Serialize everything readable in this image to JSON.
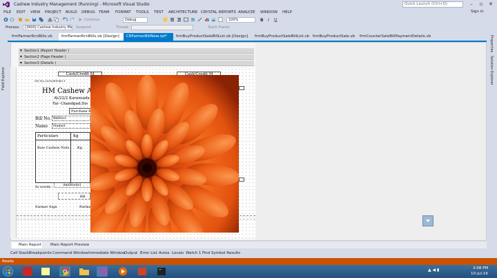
{
  "window": {
    "title": "Cashew Industry Management (Running) - Microsoft Visual Studio",
    "quick_launch_placeholder": "Quick Launch (Ctrl+Q)",
    "sign_in": "Sign in"
  },
  "menu": [
    "FILE",
    "EDIT",
    "VIEW",
    "PROJECT",
    "BUILD",
    "DEBUG",
    "TEAM",
    "FORMAT",
    "TOOLS",
    "TEST",
    "ARCHITECTURE",
    "CRYSTAL REPORTS",
    "ANALYZE",
    "WINDOW",
    "HELP"
  ],
  "toolbar": {
    "continue_label": "Continue",
    "debug_config": "Debug",
    "zoom": "100%"
  },
  "processbar": {
    "process_label": "Process:",
    "process_value": "[3900] Cashew Industry Managem",
    "suspend": "Suspend",
    "thread": "Thread:",
    "stack_frame": "Stack Frame:"
  },
  "left_tabs": [
    "Field Explorer"
  ],
  "right_tabs": [
    "Properties",
    "Solution Explorer"
  ],
  "doc_tabs": [
    {
      "label": "frmFarmerRcnBills.vb",
      "state": "normal"
    },
    {
      "label": "frmFarmerRcnBills.vb [Design]",
      "state": "hot"
    },
    {
      "label": "CRFarmerBillNew.rpt*",
      "state": "selected"
    },
    {
      "label": "frmBuyProductSaleBillList.vb [Design]",
      "state": "normal"
    },
    {
      "label": "frmBuyProductSaleBillList.vb",
      "state": "normal"
    },
    {
      "label": "frmBuyProductSale.vb",
      "state": "normal"
    },
    {
      "label": "frmCounterSaleBillPaymentDetails.vb",
      "state": "normal"
    }
  ],
  "sections": [
    "Section1 (Report Header )",
    "Section2 (Page Header )",
    "Section3 (Details )"
  ],
  "report": {
    "cash_credit_1": "Cash/Credit M",
    "cash_credit_2": "Cash/Credit M",
    "reg_no": "GN No.21003E9965-1",
    "company": "HM Cashew Agro",
    "address1": "At/22/2 Karansada M",
    "address2": "Tal- Chandgad,Dis",
    "purchase": "Purchase B",
    "bill_no_label": "Bill No.",
    "bill_no_field": "BillNo1",
    "name_label": "Name",
    "name_field": "Name1",
    "col_particulars": "Particulars",
    "col_kg": "Kg",
    "row_item": "Raw Cashew Nuts",
    "row_kg": "Kg",
    "in_words_label": "In words :",
    "amt_words": "AmtWords1",
    "bill_label": "Bill",
    "farmer_sign": "Farmer Sign",
    "partner": "Partne"
  },
  "report_tabs": [
    "Main Report",
    "Main Report Preview"
  ],
  "tool_windows": [
    "Call Stack",
    "Breakpoints",
    "Command Window",
    "Immediate Window",
    "Output",
    "Error List",
    "Autos",
    "Locals",
    "Watch 1",
    "Find Symbol Results"
  ],
  "status": "Ready",
  "clock": {
    "time": "3:08 PM",
    "date": "10-Jul-16"
  }
}
